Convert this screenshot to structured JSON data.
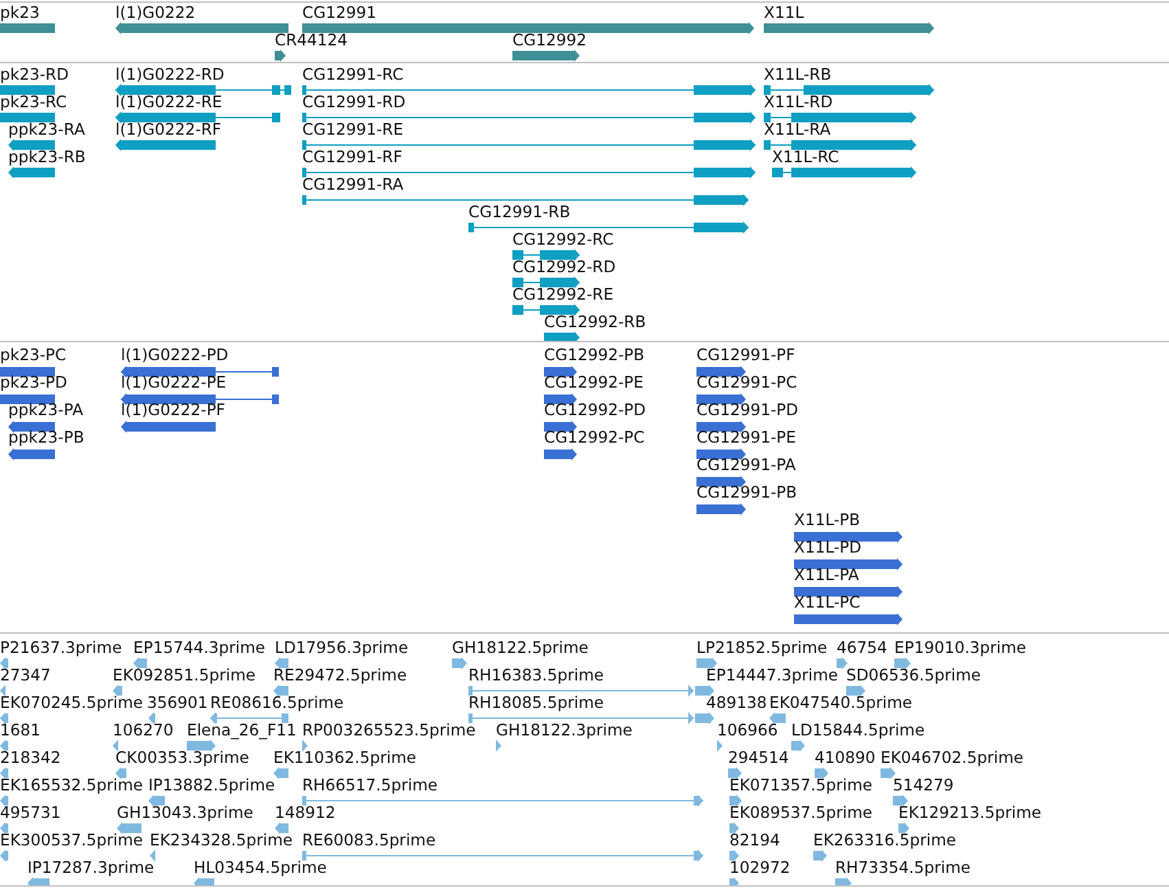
{
  "tracks": [
    {
      "kind": "genes",
      "rows": [
        {
          "features": [
            {
              "label": "pk23",
              "reverse": true
            },
            {
              "label": "l(1)G0222",
              "reverse": true
            },
            {
              "label": "CG12991",
              "reverse": false
            },
            {
              "label": "X11L",
              "reverse": false
            }
          ]
        },
        {
          "features": [
            {
              "label": "CR44124",
              "reverse": false
            },
            {
              "label": "CG12992",
              "reverse": false
            }
          ]
        }
      ]
    },
    {
      "kind": "transcripts",
      "rows": [
        {
          "features": [
            {
              "label": "pk23-RD",
              "reverse": true
            },
            {
              "label": "l(1)G0222-RD",
              "reverse": true
            },
            {
              "label": "CG12991-RC",
              "reverse": false
            },
            {
              "label": "X11L-RB",
              "reverse": false
            }
          ]
        },
        {
          "features": [
            {
              "label": "pk23-RC",
              "reverse": true
            },
            {
              "label": "l(1)G0222-RE",
              "reverse": true
            },
            {
              "label": "CG12991-RD",
              "reverse": false
            },
            {
              "label": "X11L-RD",
              "reverse": false
            }
          ]
        },
        {
          "features": [
            {
              "label": "ppk23-RA",
              "reverse": true
            },
            {
              "label": "l(1)G0222-RF",
              "reverse": true
            },
            {
              "label": "CG12991-RE",
              "reverse": false
            },
            {
              "label": "X11L-RA",
              "reverse": false
            }
          ]
        },
        {
          "features": [
            {
              "label": "ppk23-RB",
              "reverse": true
            },
            {
              "label": "CG12991-RF",
              "reverse": false
            },
            {
              "label": "X11L-RC",
              "reverse": false
            }
          ]
        },
        {
          "features": [
            {
              "label": "CG12991-RA",
              "reverse": false
            }
          ]
        },
        {
          "features": [
            {
              "label": "CG12991-RB",
              "reverse": false
            }
          ]
        },
        {
          "features": [
            {
              "label": "CG12992-RC",
              "reverse": false
            }
          ]
        },
        {
          "features": [
            {
              "label": "CG12992-RD",
              "reverse": false
            }
          ]
        },
        {
          "features": [
            {
              "label": "CG12992-RE",
              "reverse": false
            }
          ]
        },
        {
          "features": [
            {
              "label": "CG12992-RB",
              "reverse": false
            }
          ]
        }
      ]
    },
    {
      "kind": "proteins",
      "rows": [
        {
          "features": [
            {
              "label": "pk23-PC",
              "reverse": true
            },
            {
              "label": "l(1)G0222-PD",
              "reverse": true
            },
            {
              "label": "CG12992-PB",
              "reverse": false
            },
            {
              "label": "CG12991-PF",
              "reverse": false
            }
          ]
        },
        {
          "features": [
            {
              "label": "pk23-PD",
              "reverse": true
            },
            {
              "label": "l(1)G0222-PE",
              "reverse": true
            },
            {
              "label": "CG12992-PE",
              "reverse": false
            },
            {
              "label": "CG12991-PC",
              "reverse": false
            }
          ]
        },
        {
          "features": [
            {
              "label": "ppk23-PA",
              "reverse": true
            },
            {
              "label": "l(1)G0222-PF",
              "reverse": true
            },
            {
              "label": "CG12992-PD",
              "reverse": false
            },
            {
              "label": "CG12991-PD",
              "reverse": false
            }
          ]
        },
        {
          "features": [
            {
              "label": "ppk23-PB",
              "reverse": true
            },
            {
              "label": "CG12992-PC",
              "reverse": false
            },
            {
              "label": "CG12991-PE",
              "reverse": false
            }
          ]
        },
        {
          "features": [
            {
              "label": "CG12991-PA",
              "reverse": false
            }
          ]
        },
        {
          "features": [
            {
              "label": "CG12991-PB",
              "reverse": false
            }
          ]
        },
        {
          "features": [
            {
              "label": "X11L-PB",
              "reverse": false
            }
          ]
        },
        {
          "features": [
            {
              "label": "X11L-PD",
              "reverse": false
            }
          ]
        },
        {
          "features": [
            {
              "label": "X11L-PA",
              "reverse": false
            }
          ]
        },
        {
          "features": [
            {
              "label": "X11L-PC",
              "reverse": false
            }
          ]
        }
      ]
    },
    {
      "kind": "ests",
      "rows": [
        {
          "features": [
            {
              "label": "P21637.3prime",
              "reverse": true
            },
            {
              "label": "EP15744.3prime",
              "reverse": true
            },
            {
              "label": "LD17956.3prime",
              "reverse": true
            },
            {
              "label": "GH18122.5prime",
              "reverse": false
            },
            {
              "label": "LP21852.5prime",
              "reverse": false
            },
            {
              "label": "46754",
              "reverse": false
            },
            {
              "label": "EP19010.3prime",
              "reverse": false
            }
          ]
        },
        {
          "features": [
            {
              "label": "27347",
              "reverse": true
            },
            {
              "label": "EK092851.5prime",
              "reverse": true
            },
            {
              "label": "RE29472.5prime",
              "reverse": true
            },
            {
              "label": "RH16383.5prime",
              "reverse": false
            },
            {
              "label": "EP14447.3prime",
              "reverse": false
            },
            {
              "label": "SD06536.5prime",
              "reverse": false
            }
          ]
        },
        {
          "features": [
            {
              "label": "EK070245.5prime",
              "reverse": true
            },
            {
              "label": "356901",
              "reverse": true
            },
            {
              "label": "RE08616.5prime",
              "reverse": true
            },
            {
              "label": "RH18085.5prime",
              "reverse": false
            },
            {
              "label": "489138",
              "reverse": false
            },
            {
              "label": "EK047540.5prime",
              "reverse": true
            }
          ]
        },
        {
          "features": [
            {
              "label": "1681",
              "reverse": true
            },
            {
              "label": "106270",
              "reverse": true
            },
            {
              "label": "Elena_26_F11",
              "reverse": false
            },
            {
              "label": "RP003265523.5prime",
              "reverse": false
            },
            {
              "label": "GH18122.3prime",
              "reverse": false
            },
            {
              "label": "106966",
              "reverse": false
            },
            {
              "label": "LD15844.5prime",
              "reverse": false
            }
          ]
        },
        {
          "features": [
            {
              "label": "218342",
              "reverse": true
            },
            {
              "label": "CK00353.3prime",
              "reverse": true
            },
            {
              "label": "EK110362.5prime",
              "reverse": true
            },
            {
              "label": "294514",
              "reverse": false
            },
            {
              "label": "410890",
              "reverse": false
            },
            {
              "label": "EK046702.5prime",
              "reverse": false
            }
          ]
        },
        {
          "features": [
            {
              "label": "EK165532.5prime",
              "reverse": true
            },
            {
              "label": "IP13882.5prime",
              "reverse": true
            },
            {
              "label": "RH66517.5prime",
              "reverse": false
            },
            {
              "label": "EK071357.5prime",
              "reverse": false
            },
            {
              "label": "514279",
              "reverse": false
            }
          ]
        },
        {
          "features": [
            {
              "label": "495731",
              "reverse": true
            },
            {
              "label": "GH13043.3prime",
              "reverse": true
            },
            {
              "label": "148912",
              "reverse": true
            },
            {
              "label": "EK089537.5prime",
              "reverse": false
            },
            {
              "label": "EK129213.5prime",
              "reverse": false
            }
          ]
        },
        {
          "features": [
            {
              "label": "EK300537.5prime",
              "reverse": true
            },
            {
              "label": "EK234328.5prime",
              "reverse": true
            },
            {
              "label": "RE60083.5prime",
              "reverse": false
            },
            {
              "label": "82194",
              "reverse": false
            },
            {
              "label": "EK263316.5prime",
              "reverse": false
            }
          ]
        },
        {
          "features": [
            {
              "label": "IP17287.3prime",
              "reverse": true
            },
            {
              "label": "HL03454.5prime",
              "reverse": true
            },
            {
              "label": "102972",
              "reverse": false
            },
            {
              "label": "RH73354.5prime",
              "reverse": false
            }
          ]
        }
      ]
    }
  ]
}
